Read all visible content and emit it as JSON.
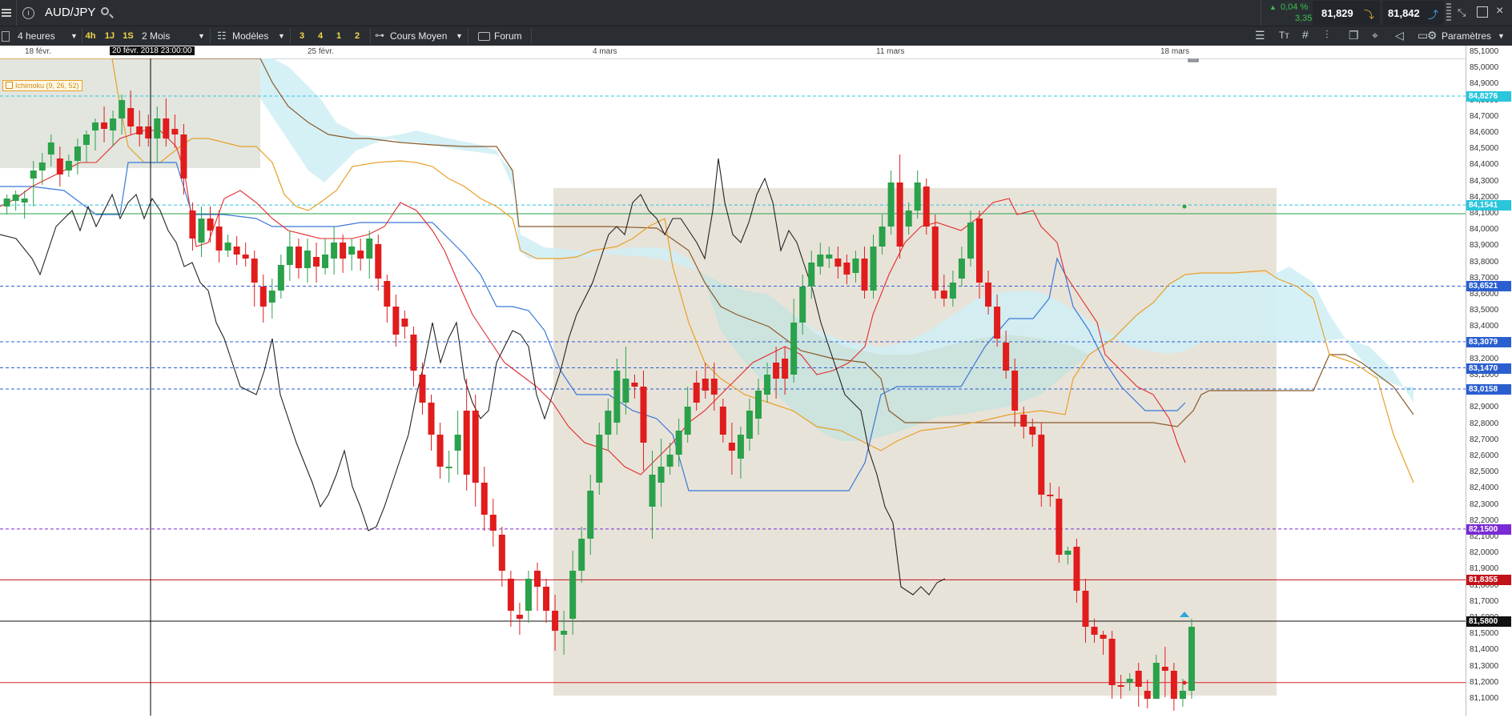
{
  "window": {
    "symbol": "AUD/JPY"
  },
  "quote": {
    "change_pct": "0,04 %",
    "change_abs": "3,35",
    "sell": "81,829",
    "buy": "81,842"
  },
  "toolbar": {
    "timeframe": "4 heures",
    "quick_frames": [
      "4h",
      "1J",
      "1S"
    ],
    "range": "2 Mois",
    "templates": "Modèles",
    "num_buttons": [
      "3",
      "4",
      "1",
      "2"
    ],
    "price_type": "Cours Moyen",
    "forum": "Forum",
    "settings": "Paramètres"
  },
  "chart": {
    "cursor_date": "20 févr. 2018 23:00:00",
    "indicator_label": "Ichimoku (9, 26, 52)",
    "x_labels": [
      "18 févr.",
      "25 févr.",
      "4 mars",
      "11 mars",
      "18 mars"
    ],
    "price_ticks": [
      "85,1000",
      "85,0000",
      "84,9000",
      "84,8000",
      "84,7000",
      "84,6000",
      "84,5000",
      "84,4000",
      "84,3000",
      "84,2000",
      "84,1000",
      "84,0000",
      "83,9000",
      "83,8000",
      "83,7000",
      "83,6000",
      "83,5000",
      "83,4000",
      "83,3000",
      "83,2000",
      "83,1000",
      "83,0000",
      "82,9000",
      "82,8000",
      "82,7000",
      "82,6000",
      "82,5000",
      "82,4000",
      "82,3000",
      "82,2000",
      "82,1000",
      "82,0000",
      "81,9000",
      "81,8000",
      "81,7000",
      "81,6000",
      "81,5000",
      "81,4000",
      "81,3000",
      "81,2000",
      "81,1000"
    ],
    "price_badges": [
      {
        "text": "84,8276",
        "color": "#29c6dc"
      },
      {
        "text": "84,1541",
        "color": "#29c6dc"
      },
      {
        "text": "83,6521",
        "color": "#2b5fd0"
      },
      {
        "text": "83,3079",
        "color": "#2b5fd0"
      },
      {
        "text": "83,1470",
        "color": "#2b5fd0"
      },
      {
        "text": "83,0158",
        "color": "#2b5fd0"
      },
      {
        "text": "82,1500",
        "color": "#7a2ad6"
      },
      {
        "text": "81,8355",
        "color": "#c2121a"
      },
      {
        "text": "81,5800",
        "color": "#111111"
      }
    ]
  }
}
